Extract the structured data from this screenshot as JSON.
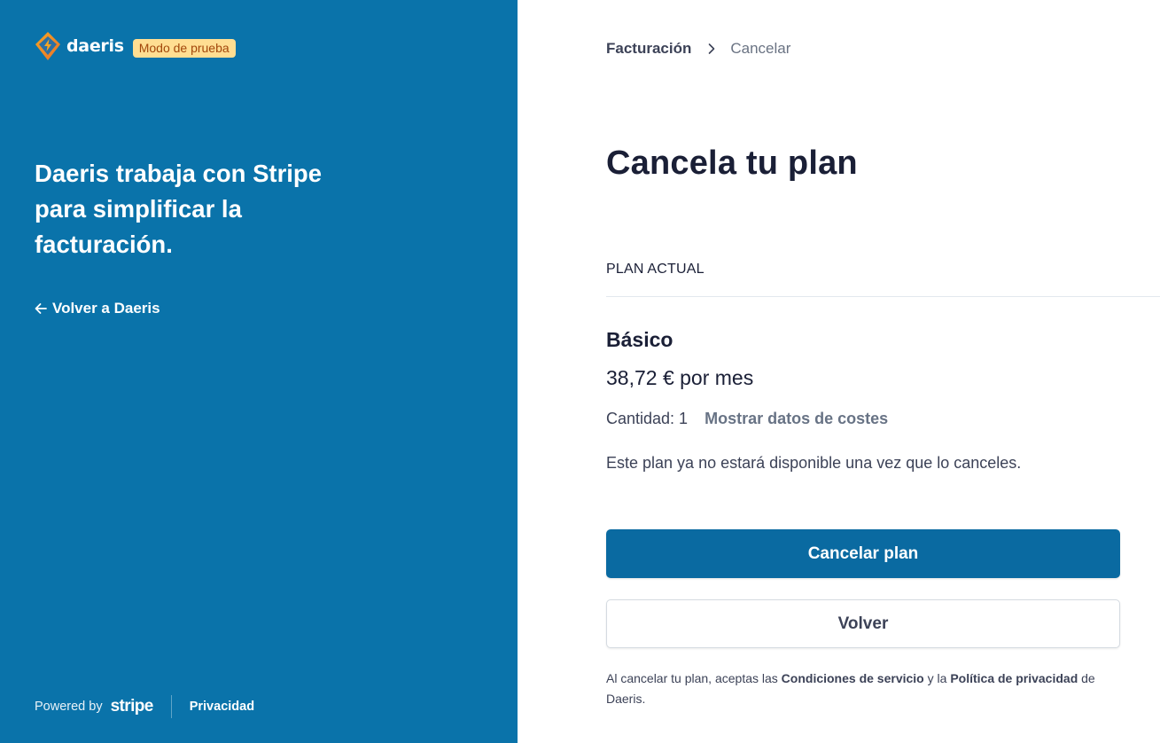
{
  "brand": {
    "name": "daeris",
    "badge": "Modo de prueba"
  },
  "left": {
    "tagline": "Daeris trabaja con Stripe para simplificar la facturación.",
    "back_link": "Volver a Daeris",
    "footer": {
      "powered_by": "Powered by",
      "stripe": "stripe",
      "privacy": "Privacidad"
    }
  },
  "breadcrumb": {
    "parent": "Facturación",
    "current": "Cancelar"
  },
  "page_title": "Cancela tu plan",
  "section_label": "PLAN ACTUAL",
  "plan": {
    "name": "Básico",
    "price": "38,72 € por mes",
    "quantity": "Cantidad: 1",
    "costs_link": "Mostrar datos de costes",
    "note": "Este plan ya no estará disponible una vez que lo canceles."
  },
  "actions": {
    "cancel_label": "Cancelar plan",
    "back_label": "Volver"
  },
  "legal": {
    "prefix": "Al cancelar tu plan, aceptas las",
    "terms": "Condiciones de servicio",
    "and": "y la",
    "privacy": "Política de privacidad",
    "suffix": "de Daeris."
  },
  "colors": {
    "left_bg": "#0a73aa",
    "primary_button": "#0a6aa1",
    "badge_bg": "#ffde92",
    "badge_text": "#a2470b"
  },
  "icons": {
    "logo": "daeris-bolt-logo-icon",
    "back": "arrow-left-icon",
    "separator": "chevron-right-icon"
  }
}
